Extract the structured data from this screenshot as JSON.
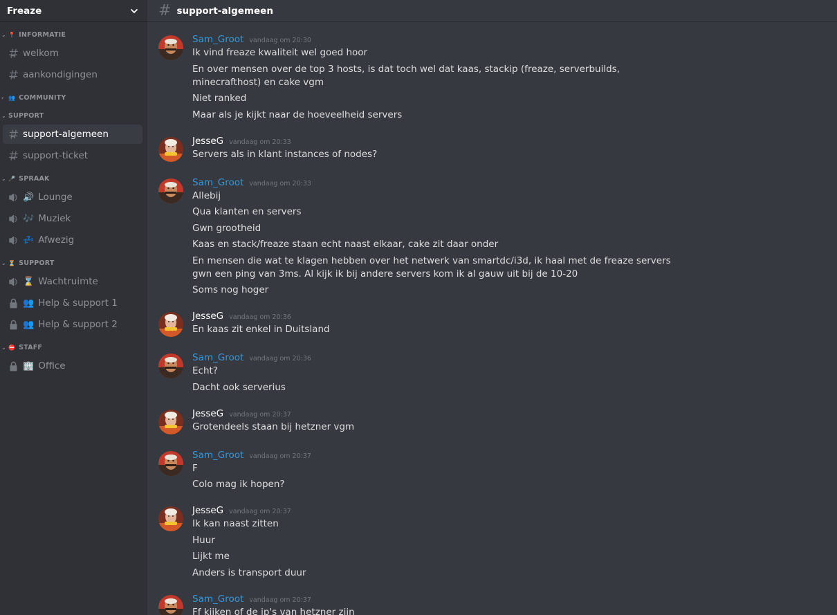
{
  "server": {
    "name": "Freaze"
  },
  "header": {
    "channel": "support-algemeen"
  },
  "categories": [
    {
      "name": "INFORMATIE",
      "emoji": "📍",
      "caret": "⌄",
      "channels": [
        {
          "label": "welkom",
          "type": "text"
        },
        {
          "label": "aankondigingen",
          "type": "text"
        }
      ]
    },
    {
      "name": "COMMUNITY",
      "emoji": "👥",
      "caret": "›",
      "channels": []
    },
    {
      "name": "SUPPORT",
      "emoji": "",
      "caret": "⌄",
      "channels": [
        {
          "label": "support-algemeen",
          "type": "text",
          "active": true
        },
        {
          "label": "support-ticket",
          "type": "text"
        }
      ]
    },
    {
      "name": "SPRAAK",
      "emoji": "🎤",
      "caret": "⌄",
      "channels": [
        {
          "label": "Lounge",
          "type": "voice",
          "emoji": "🔊"
        },
        {
          "label": "Muziek",
          "type": "voice",
          "emoji": "🎶"
        },
        {
          "label": "Afwezig",
          "type": "voice",
          "emoji": "💤"
        }
      ]
    },
    {
      "name": "SUPPORT",
      "emoji": "⏳",
      "caret": "⌄",
      "channels": [
        {
          "label": "Wachtruimte",
          "type": "voice",
          "emoji": "⌛"
        },
        {
          "label": "Help & support 1",
          "type": "locked",
          "emoji": "👥"
        },
        {
          "label": "Help & support 2",
          "type": "locked",
          "emoji": "👥"
        }
      ]
    },
    {
      "name": "STAFF",
      "emoji": "⛔",
      "caret": "⌄",
      "channels": [
        {
          "label": "Office",
          "type": "locked",
          "emoji": "🏢"
        }
      ]
    }
  ],
  "messages": [
    {
      "user": "Sam_Groot",
      "color": "blue",
      "time": "vandaag om 20:30",
      "lines": [
        "Ik vind freaze kwaliteit wel goed hoor",
        "En over mensen over de top 3 hosts, is dat toch wel dat kaas, stackip (freaze, serverbuilds, minecrafthost) en cake vgm",
        "Niet ranked",
        "Maar als je kijkt naar de hoeveelheid servers"
      ]
    },
    {
      "user": "JesseG",
      "color": "white",
      "time": "vandaag om 20:33",
      "lines": [
        "Servers als in klant instances of nodes?"
      ]
    },
    {
      "user": "Sam_Groot",
      "color": "blue",
      "time": "vandaag om 20:33",
      "lines": [
        "Allebij",
        "Qua klanten en servers",
        "Gwn grootheid",
        "Kaas en stack/freaze staan echt naast elkaar, cake zit daar onder",
        "En mensen die wat te klagen hebben over het netwerk van smartdc/i3d, ik haal met de freaze servers gwn een ping van 3ms. Al kijk ik bij andere servers kom ik al gauw uit bij de 10-20",
        "Soms nog hoger"
      ]
    },
    {
      "user": "JesseG",
      "color": "white",
      "time": "vandaag om 20:36",
      "lines": [
        "En kaas zit enkel in Duitsland"
      ]
    },
    {
      "user": "Sam_Groot",
      "color": "blue",
      "time": "vandaag om 20:36",
      "lines": [
        "Echt?",
        "Dacht ook serverius"
      ]
    },
    {
      "user": "JesseG",
      "color": "white",
      "time": "vandaag om 20:37",
      "lines": [
        "Grotendeels staan bij hetzner vgm"
      ]
    },
    {
      "user": "Sam_Groot",
      "color": "blue",
      "time": "vandaag om 20:37",
      "lines": [
        "F",
        "Colo mag ik hopen?"
      ]
    },
    {
      "user": "JesseG",
      "color": "white",
      "time": "vandaag om 20:37",
      "lines": [
        "Ik kan naast zitten",
        "Huur",
        "Lijkt me",
        "Anders is transport duur"
      ]
    },
    {
      "user": "Sam_Groot",
      "color": "blue",
      "time": "vandaag om 20:37",
      "lines": [
        "Ff kijken of de ip's van hetzner zijn"
      ]
    }
  ],
  "colors": {
    "sidebar_bg": "#2f3136",
    "chat_bg": "#36393f",
    "username_blue": "#3498db",
    "muted": "#8e9297"
  }
}
